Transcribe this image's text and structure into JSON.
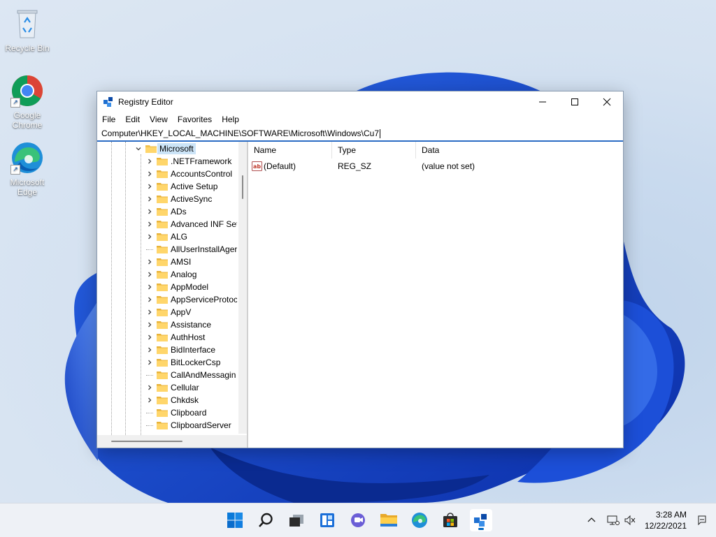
{
  "desktop": {
    "icons": [
      {
        "label": "Recycle Bin"
      },
      {
        "label": "Google Chrome"
      },
      {
        "label": "Microsoft Edge"
      }
    ]
  },
  "window": {
    "title": "Registry Editor",
    "menu": [
      "File",
      "Edit",
      "View",
      "Favorites",
      "Help"
    ],
    "address": "Computer\\HKEY_LOCAL_MACHINE\\SOFTWARE\\Microsoft\\Windows\\Cu7",
    "tree": {
      "selected": "Microsoft",
      "children": [
        {
          "label": ".NETFramework",
          "expandable": true
        },
        {
          "label": "AccountsControl",
          "expandable": true
        },
        {
          "label": "Active Setup",
          "expandable": true
        },
        {
          "label": "ActiveSync",
          "expandable": true
        },
        {
          "label": "ADs",
          "expandable": true
        },
        {
          "label": "Advanced INF Set",
          "expandable": true
        },
        {
          "label": "ALG",
          "expandable": true
        },
        {
          "label": "AllUserInstallAger",
          "expandable": false
        },
        {
          "label": "AMSI",
          "expandable": true
        },
        {
          "label": "Analog",
          "expandable": true
        },
        {
          "label": "AppModel",
          "expandable": true
        },
        {
          "label": "AppServiceProtoc",
          "expandable": true
        },
        {
          "label": "AppV",
          "expandable": true
        },
        {
          "label": "Assistance",
          "expandable": true
        },
        {
          "label": "AuthHost",
          "expandable": true
        },
        {
          "label": "BidInterface",
          "expandable": true
        },
        {
          "label": "BitLockerCsp",
          "expandable": true
        },
        {
          "label": "CallAndMessagin",
          "expandable": false
        },
        {
          "label": "Cellular",
          "expandable": true
        },
        {
          "label": "Chkdsk",
          "expandable": true
        },
        {
          "label": "Clipboard",
          "expandable": false
        },
        {
          "label": "ClipboardServer",
          "expandable": false
        }
      ]
    },
    "values_pane": {
      "columns": [
        "Name",
        "Type",
        "Data"
      ],
      "rows": [
        {
          "name": "(Default)",
          "type": "REG_SZ",
          "data": "(value not set)"
        }
      ]
    }
  },
  "taskbar": {
    "apps": [
      "start-icon",
      "search-icon",
      "task-view-icon",
      "widgets-icon",
      "chat-icon",
      "file-explorer-icon",
      "edge-icon",
      "store-icon",
      "registry-editor-icon"
    ],
    "active_app": "registry-editor-icon",
    "accent_color": "#0067c0"
  },
  "clock": {
    "time": "3:28 AM",
    "date": "12/22/2021"
  }
}
